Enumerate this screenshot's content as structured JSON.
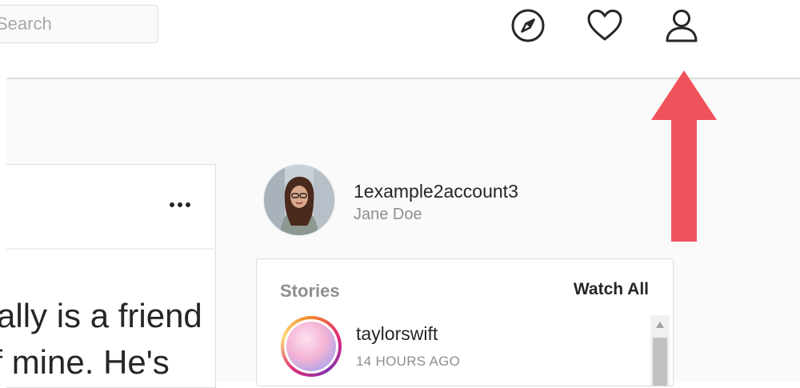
{
  "header": {
    "search": {
      "value": "",
      "placeholder": "Search"
    },
    "icons": [
      "compass-icon",
      "heart-icon",
      "profile-icon"
    ]
  },
  "post": {
    "text": "Sally is a friend of mine. He's"
  },
  "profile": {
    "username": "1example2account3",
    "full_name": "Jane Doe"
  },
  "stories": {
    "title": "Stories",
    "watch_all": "Watch All",
    "items": [
      {
        "username": "taylorswift",
        "time": "14 HOURS AGO"
      }
    ]
  },
  "annotation": {
    "arrow_color": "#f0525c"
  },
  "colors": {
    "border": "#dbdbdb",
    "muted_text": "#8e8e8e",
    "main_text": "#262626",
    "background": "#fafafa"
  }
}
